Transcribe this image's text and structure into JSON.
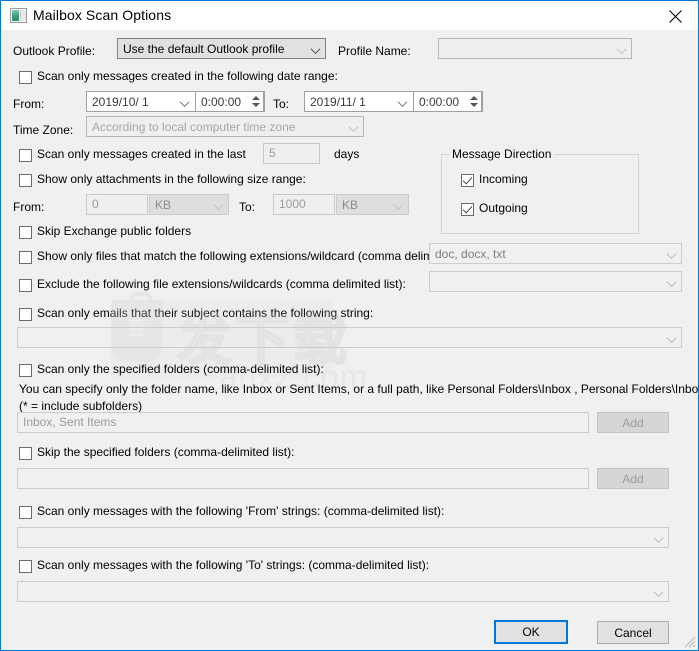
{
  "window": {
    "title": "Mailbox Scan Options",
    "icon": "window-panel-icon",
    "close_icon": "close-icon",
    "accent_color": "#0078d7",
    "background_color": "#f0f0f0"
  },
  "profile": {
    "outlook_profile_label": "Outlook Profile:",
    "outlook_profile_value": "Use the default Outlook profile",
    "profile_name_label": "Profile Name:",
    "profile_name_value": ""
  },
  "date_range": {
    "checkbox_label": "Scan only messages created in the following date range:",
    "checked": false,
    "from_label": "From:",
    "from_date": "2019/10/ 1",
    "from_time": "0:00:00",
    "to_label": "To:",
    "to_date": "2019/11/ 1",
    "to_time": "0:00:00",
    "time_zone_label": "Time Zone:",
    "time_zone_value": "According to local computer time zone"
  },
  "last_days": {
    "checkbox_label": "Scan only messages created in the last",
    "checked": false,
    "value": "5",
    "unit_label": "days"
  },
  "size_range": {
    "checkbox_label": "Show only attachments in the following size range:",
    "checked": false,
    "from_label": "From:",
    "from_value": "0",
    "from_unit": "KB",
    "to_label": "To:",
    "to_value": "1000",
    "to_unit": "KB"
  },
  "message_direction": {
    "group_title": "Message Direction",
    "incoming_label": "Incoming",
    "incoming_checked": true,
    "outgoing_label": "Outgoing",
    "outgoing_checked": true
  },
  "options": {
    "skip_public_folders_label": "Skip Exchange public folders",
    "skip_public_folders_checked": false,
    "include_ext_label": "Show only files that match the following extensions/wildcard (comma delimited):",
    "include_ext_checked": false,
    "include_ext_value": "doc, docx, txt",
    "exclude_ext_label": "Exclude the following file extensions/wildcards (comma delimited list):",
    "exclude_ext_checked": false,
    "exclude_ext_value": "",
    "subject_label": "Scan only emails that their subject contains the following string:",
    "subject_checked": false,
    "subject_value": ""
  },
  "scan_folders": {
    "checkbox_label": "Scan only the specified folders (comma-delimited list):",
    "checked": false,
    "hint_line1": "You can specify only the folder name, like Inbox or Sent Items, or a full path, like Personal Folders\\Inbox , Personal Folders\\Inbox*",
    "hint_line2": " (* = include subfolders)",
    "input_placeholder": "Inbox, Sent Items",
    "add_button_label": "Add"
  },
  "skip_folders": {
    "checkbox_label": "Skip the specified folders (comma-delimited list):",
    "checked": false,
    "input_value": "",
    "add_button_label": "Add"
  },
  "from_strings": {
    "checkbox_label": "Scan only messages with the following 'From' strings: (comma-delimited list):",
    "checked": false,
    "value": ""
  },
  "to_strings": {
    "checkbox_label": "Scan only messages with the following 'To' strings: (comma-delimited list):",
    "checked": false,
    "value": ""
  },
  "footer": {
    "ok_label": "OK",
    "cancel_label": "Cancel"
  },
  "watermark": {
    "text_cn": "发下载",
    "text_url": "anxz.com",
    "badge_glyph": "豆"
  }
}
